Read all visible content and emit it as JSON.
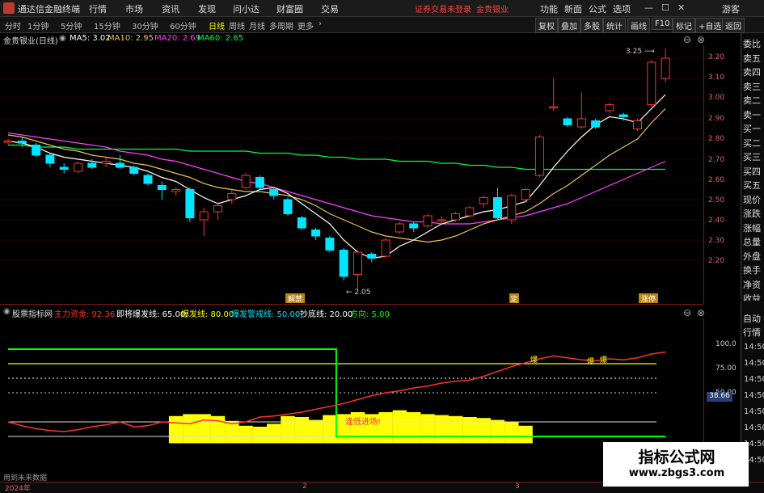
{
  "titlebar": {
    "app": "通达信金融终端",
    "menu": [
      "行情",
      "市场",
      "资讯",
      "发现",
      "问小达",
      "财富圈",
      "交易"
    ],
    "warnings": [
      "证券交易未登录",
      "金贵银业"
    ],
    "right_menu": [
      "功能",
      "新面",
      "公式",
      "选项"
    ],
    "right_extra": "游客"
  },
  "toolbar": {
    "periods": [
      "分时",
      "1分钟",
      "5分钟",
      "15分钟",
      "30分钟",
      "60分钟",
      "日线",
      "周线",
      "月线",
      "多周期",
      "更多"
    ],
    "active_period": "日线",
    "right_buttons": [
      "复权",
      "叠加",
      "多股",
      "统计",
      "画线",
      "F10",
      "标记",
      "+自选",
      "返回"
    ]
  },
  "info": {
    "stock": "金贵银业(日线)",
    "ma5": "MA5: 3.02",
    "ma10": "MA10: 2.95",
    "ma20": "MA20: 2.69",
    "ma60": "MA60: 2.65"
  },
  "price_axis": [
    "3.20",
    "3.10",
    "3.00",
    "2.90",
    "2.80",
    "2.70",
    "2.60",
    "2.50",
    "2.40",
    "2.30",
    "2.20"
  ],
  "annotations": {
    "high": "3.25",
    "low": "2.05",
    "mark1": "解禁",
    "mark2": "定",
    "mark3": "涨停"
  },
  "side_panel": [
    "委比",
    "卖五",
    "卖四",
    "卖三",
    "卖二",
    "卖一",
    "买一",
    "买二",
    "买三",
    "买四",
    "买五",
    "现价",
    "涨跌",
    "涨幅",
    "总量",
    "外盘",
    "换手",
    "净资",
    "收益"
  ],
  "indicator": {
    "name": "股票指标网",
    "l1": "主力资金: 92.36",
    "l2": "即将爆发线: 65.00",
    "l3": "爆发线: 80.00",
    "l4": "爆发警戒线: 50.00",
    "l5": "抄底线: 20.00",
    "l6": "方向: 5.00",
    "annotation": "逢低进场!",
    "badge": "38.66",
    "axis": [
      "100.0",
      "75.00",
      "50.00"
    ],
    "future_note": "用到未来数据",
    "signal_marks": [
      "爆",
      "爆",
      "爆"
    ]
  },
  "right_tabs": {
    "auto": "自动",
    "quote": "行情",
    "times": [
      "14:50",
      "14:50",
      "14:50",
      "14:50",
      "14:50",
      "14:50",
      "14:50",
      "14:50"
    ]
  },
  "dates": [
    "2024年",
    "2",
    "3"
  ],
  "watermark": {
    "title": "指标公式网",
    "url": "www.zbgs3.com"
  },
  "colors": {
    "up": "#ff3030",
    "down": "#00e5ff",
    "ma5": "#ffffff",
    "ma10": "#e6c35c",
    "ma20": "#ff40ff",
    "ma60": "#00ff40",
    "yellow": "#ffff00",
    "green": "#00ff00"
  },
  "chart_data": [
    {
      "type": "candlestick",
      "title": "金贵银业(日线)",
      "ylim": [
        2.15,
        3.25
      ],
      "candles": [
        {
          "o": 2.79,
          "c": 2.79,
          "h": 2.8,
          "l": 2.77
        },
        {
          "o": 2.79,
          "c": 2.78,
          "h": 2.81,
          "l": 2.76
        },
        {
          "o": 2.77,
          "c": 2.72,
          "h": 2.78,
          "l": 2.71
        },
        {
          "o": 2.72,
          "c": 2.68,
          "h": 2.73,
          "l": 2.66
        },
        {
          "o": 2.66,
          "c": 2.65,
          "h": 2.68,
          "l": 2.63
        },
        {
          "o": 2.64,
          "c": 2.68,
          "h": 2.69,
          "l": 2.63
        },
        {
          "o": 2.68,
          "c": 2.66,
          "h": 2.7,
          "l": 2.65
        },
        {
          "o": 2.68,
          "c": 2.69,
          "h": 2.71,
          "l": 2.66
        },
        {
          "o": 2.68,
          "c": 2.66,
          "h": 2.72,
          "l": 2.65
        },
        {
          "o": 2.66,
          "c": 2.63,
          "h": 2.67,
          "l": 2.62
        },
        {
          "o": 2.62,
          "c": 2.58,
          "h": 2.63,
          "l": 2.57
        },
        {
          "o": 2.57,
          "c": 2.55,
          "h": 2.59,
          "l": 2.5
        },
        {
          "o": 2.54,
          "c": 2.55,
          "h": 2.56,
          "l": 2.52
        },
        {
          "o": 2.55,
          "c": 2.41,
          "h": 2.56,
          "l": 2.39
        },
        {
          "o": 2.4,
          "c": 2.44,
          "h": 2.46,
          "l": 2.32
        },
        {
          "o": 2.44,
          "c": 2.47,
          "h": 2.49,
          "l": 2.4
        },
        {
          "o": 2.5,
          "c": 2.53,
          "h": 2.55,
          "l": 2.48
        },
        {
          "o": 2.56,
          "c": 2.62,
          "h": 2.63,
          "l": 2.55
        },
        {
          "o": 2.61,
          "c": 2.56,
          "h": 2.62,
          "l": 2.55
        },
        {
          "o": 2.55,
          "c": 2.52,
          "h": 2.56,
          "l": 2.5
        },
        {
          "o": 2.5,
          "c": 2.43,
          "h": 2.51,
          "l": 2.42
        },
        {
          "o": 2.41,
          "c": 2.36,
          "h": 2.42,
          "l": 2.35
        },
        {
          "o": 2.35,
          "c": 2.32,
          "h": 2.36,
          "l": 2.3
        },
        {
          "o": 2.31,
          "c": 2.25,
          "h": 2.32,
          "l": 2.24
        },
        {
          "o": 2.25,
          "c": 2.12,
          "h": 2.26,
          "l": 2.1
        },
        {
          "o": 2.13,
          "c": 2.24,
          "h": 2.25,
          "l": 2.05
        },
        {
          "o": 2.23,
          "c": 2.21,
          "h": 2.24,
          "l": 2.19
        },
        {
          "o": 2.22,
          "c": 2.3,
          "h": 2.31,
          "l": 2.21
        },
        {
          "o": 2.34,
          "c": 2.38,
          "h": 2.39,
          "l": 2.33
        },
        {
          "o": 2.38,
          "c": 2.36,
          "h": 2.39,
          "l": 2.34
        },
        {
          "o": 2.37,
          "c": 2.42,
          "h": 2.43,
          "l": 2.36
        },
        {
          "o": 2.4,
          "c": 2.4,
          "h": 2.42,
          "l": 2.38
        },
        {
          "o": 2.4,
          "c": 2.43,
          "h": 2.44,
          "l": 2.39
        },
        {
          "o": 2.42,
          "c": 2.46,
          "h": 2.47,
          "l": 2.41
        },
        {
          "o": 2.48,
          "c": 2.51,
          "h": 2.52,
          "l": 2.46
        },
        {
          "o": 2.51,
          "c": 2.41,
          "h": 2.56,
          "l": 2.4
        },
        {
          "o": 2.4,
          "c": 2.52,
          "h": 2.53,
          "l": 2.38
        },
        {
          "o": 2.5,
          "c": 2.55,
          "h": 2.56,
          "l": 2.49
        },
        {
          "o": 2.62,
          "c": 2.81,
          "h": 2.82,
          "l": 2.61
        },
        {
          "o": 2.96,
          "c": 2.96,
          "h": 3.1,
          "l": 2.94
        },
        {
          "o": 2.9,
          "c": 2.87,
          "h": 2.91,
          "l": 2.86
        },
        {
          "o": 2.86,
          "c": 2.9,
          "h": 3.03,
          "l": 2.85
        },
        {
          "o": 2.89,
          "c": 2.86,
          "h": 2.9,
          "l": 2.85
        },
        {
          "o": 2.94,
          "c": 2.97,
          "h": 2.98,
          "l": 2.93
        },
        {
          "o": 2.92,
          "c": 2.91,
          "h": 2.93,
          "l": 2.89
        },
        {
          "o": 2.85,
          "c": 2.89,
          "h": 2.9,
          "l": 2.84
        },
        {
          "o": 2.97,
          "c": 3.18,
          "h": 3.19,
          "l": 2.96
        },
        {
          "o": 3.1,
          "c": 3.2,
          "h": 3.25,
          "l": 3.08
        }
      ],
      "ma5": [
        2.79,
        2.78,
        2.76,
        2.73,
        2.71,
        2.7,
        2.69,
        2.68,
        2.67,
        2.66,
        2.64,
        2.61,
        2.59,
        2.55,
        2.51,
        2.48,
        2.5,
        2.52,
        2.55,
        2.56,
        2.53,
        2.48,
        2.43,
        2.38,
        2.3,
        2.24,
        2.21,
        2.22,
        2.27,
        2.3,
        2.34,
        2.38,
        2.4,
        2.42,
        2.44,
        2.45,
        2.47,
        2.49,
        2.57,
        2.66,
        2.74,
        2.81,
        2.87,
        2.91,
        2.9,
        2.88,
        2.95,
        3.02
      ],
      "ma10": [
        2.82,
        2.81,
        2.79,
        2.77,
        2.75,
        2.74,
        2.72,
        2.71,
        2.7,
        2.68,
        2.67,
        2.65,
        2.63,
        2.61,
        2.58,
        2.56,
        2.55,
        2.54,
        2.54,
        2.53,
        2.52,
        2.5,
        2.47,
        2.43,
        2.4,
        2.37,
        2.34,
        2.32,
        2.31,
        2.3,
        2.29,
        2.3,
        2.32,
        2.35,
        2.38,
        2.4,
        2.42,
        2.44,
        2.48,
        2.53,
        2.57,
        2.62,
        2.67,
        2.72,
        2.76,
        2.8,
        2.88,
        2.95
      ],
      "ma20": [
        2.83,
        2.82,
        2.81,
        2.8,
        2.79,
        2.78,
        2.77,
        2.76,
        2.74,
        2.73,
        2.72,
        2.7,
        2.69,
        2.67,
        2.65,
        2.63,
        2.61,
        2.59,
        2.58,
        2.56,
        2.54,
        2.52,
        2.5,
        2.48,
        2.46,
        2.44,
        2.42,
        2.41,
        2.4,
        2.39,
        2.39,
        2.38,
        2.38,
        2.38,
        2.39,
        2.4,
        2.41,
        2.42,
        2.44,
        2.46,
        2.48,
        2.51,
        2.54,
        2.57,
        2.6,
        2.63,
        2.66,
        2.69
      ],
      "ma60": [
        2.77,
        2.77,
        2.76,
        2.76,
        2.76,
        2.75,
        2.75,
        2.75,
        2.75,
        2.75,
        2.75,
        2.75,
        2.75,
        2.74,
        2.74,
        2.74,
        2.74,
        2.74,
        2.73,
        2.73,
        2.73,
        2.72,
        2.72,
        2.71,
        2.71,
        2.7,
        2.7,
        2.7,
        2.69,
        2.69,
        2.69,
        2.68,
        2.68,
        2.67,
        2.67,
        2.66,
        2.66,
        2.65,
        2.65,
        2.65,
        2.65,
        2.65,
        2.65,
        2.65,
        2.65,
        2.65,
        2.65,
        2.65
      ]
    },
    {
      "type": "line",
      "title": "股票指标网",
      "ylim": [
        0,
        100
      ],
      "series": [
        {
          "name": "主力资金",
          "values": [
            20,
            16,
            13,
            11,
            10,
            12,
            15,
            17,
            20,
            15,
            16,
            20,
            19,
            18,
            22,
            21,
            18,
            20,
            25,
            26,
            28,
            30,
            33,
            36,
            39,
            43,
            47,
            50,
            52,
            55,
            57,
            60,
            62,
            63,
            67,
            72,
            77,
            81,
            85,
            88,
            86,
            84,
            83,
            85,
            84,
            86,
            90,
            92
          ]
        },
        {
          "name": "即将爆发线",
          "values": [
            65
          ]
        },
        {
          "name": "爆发线",
          "values": [
            80
          ]
        },
        {
          "name": "爆发警戒线",
          "values": [
            50
          ]
        },
        {
          "name": "抄底线",
          "values": [
            20
          ]
        },
        {
          "name": "方向",
          "values": [
            95,
            95,
            95,
            95,
            95,
            95,
            95,
            95,
            95,
            95,
            95,
            95,
            95,
            95,
            95,
            95,
            95,
            95,
            95,
            95,
            95,
            95,
            95,
            95,
            5,
            5,
            5,
            5,
            5,
            5,
            5,
            5,
            5,
            5,
            5,
            5,
            5,
            5,
            5,
            5,
            5,
            5,
            5,
            5,
            5,
            5,
            5,
            5
          ]
        }
      ],
      "bars": [
        0,
        0,
        0,
        0,
        0,
        0,
        0,
        0,
        0,
        0,
        0,
        0,
        20,
        22,
        22,
        20,
        15,
        10,
        9,
        12,
        20,
        19,
        16,
        21,
        22,
        24,
        22,
        24,
        26,
        24,
        22,
        21,
        20,
        19,
        18,
        16,
        14,
        10,
        0,
        0,
        0,
        0,
        0,
        0,
        0,
        0,
        0,
        0
      ]
    }
  ]
}
